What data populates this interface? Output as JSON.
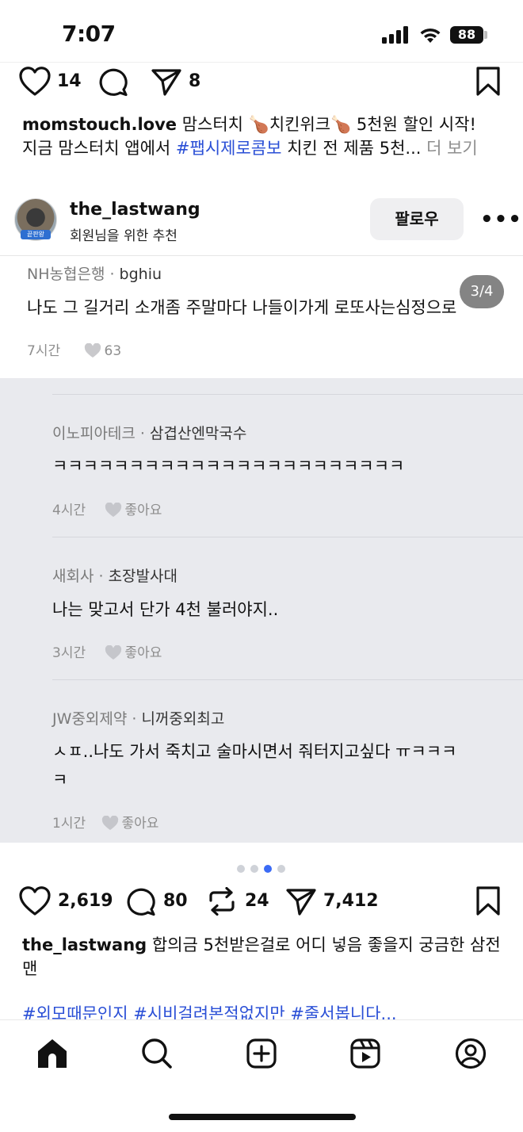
{
  "status_bar": {
    "time": "7:07",
    "battery": "88"
  },
  "top_post": {
    "like_count": "14",
    "share_count": "8",
    "caption_user": "momstouch.love",
    "caption_text_1": " 맘스터치 🍗치킨위크🍗 5천원 할인 시작!",
    "caption_text_2a": "지금 맘스터치 앱에서 ",
    "caption_tag": "#팹시제로콤보",
    "caption_text_2b": " 치킨 전 제품 5천...",
    "more": " 더 보기"
  },
  "post": {
    "username": "the_lastwang",
    "subtitle": "회원님을 위한 추천",
    "follow_label": "팔로우",
    "more_label": "•••",
    "avatar_label": "끝판왕",
    "page_indicator": "3/4",
    "like_count": "2,619",
    "comment_count": "80",
    "repost_count": "24",
    "share_count": "7,412",
    "caption_user": "the_lastwang",
    "caption_text": " 합의금 5천받은걸로 어디 넣음 좋을지 궁금한 삼전맨",
    "hashtags": "#외모때문인지 #시비걸려본적없지만 #줄서봅니다..."
  },
  "comments": [
    {
      "company": "NH농협은행",
      "nick": "bghiu",
      "text": "나도 그 길거리 소개좀 주말마다 나들이가게 로또사는심정으로",
      "time": "7시간",
      "likes": "63"
    },
    {
      "company": "이노피아테크",
      "nick": "삼겹산엔막국수",
      "text": "ㅋㅋㅋㅋㅋㅋㅋㅋㅋㅋㅋㅋㅋㅋㅋㅋㅋㅋㅋㅋㅋㅋㅋ",
      "time": "4시간",
      "likes": "좋아요"
    },
    {
      "company": "새회사",
      "nick": "초장발사대",
      "text": "나는 맞고서 단가 4천 불러야지..",
      "time": "3시간",
      "likes": "좋아요"
    },
    {
      "company": "JW중외제약",
      "nick": "니꺼중외최고",
      "text_1": "ㅅㅍ..나도 가서 죽치고 술마시면서 줘터지고싶다 ㅠㅋㅋㅋ",
      "text_2": "ㅋ",
      "time": "1시간",
      "likes": "좋아요"
    }
  ],
  "carousel": {
    "count": 4,
    "active_index": 2
  },
  "nav": [
    "home-icon",
    "search-icon",
    "create-icon",
    "reels-icon",
    "profile-icon"
  ],
  "colors": {
    "hashtag": "#2a4fd6",
    "carousel_active": "#3b6bf5",
    "panel": "#e9eaee"
  }
}
